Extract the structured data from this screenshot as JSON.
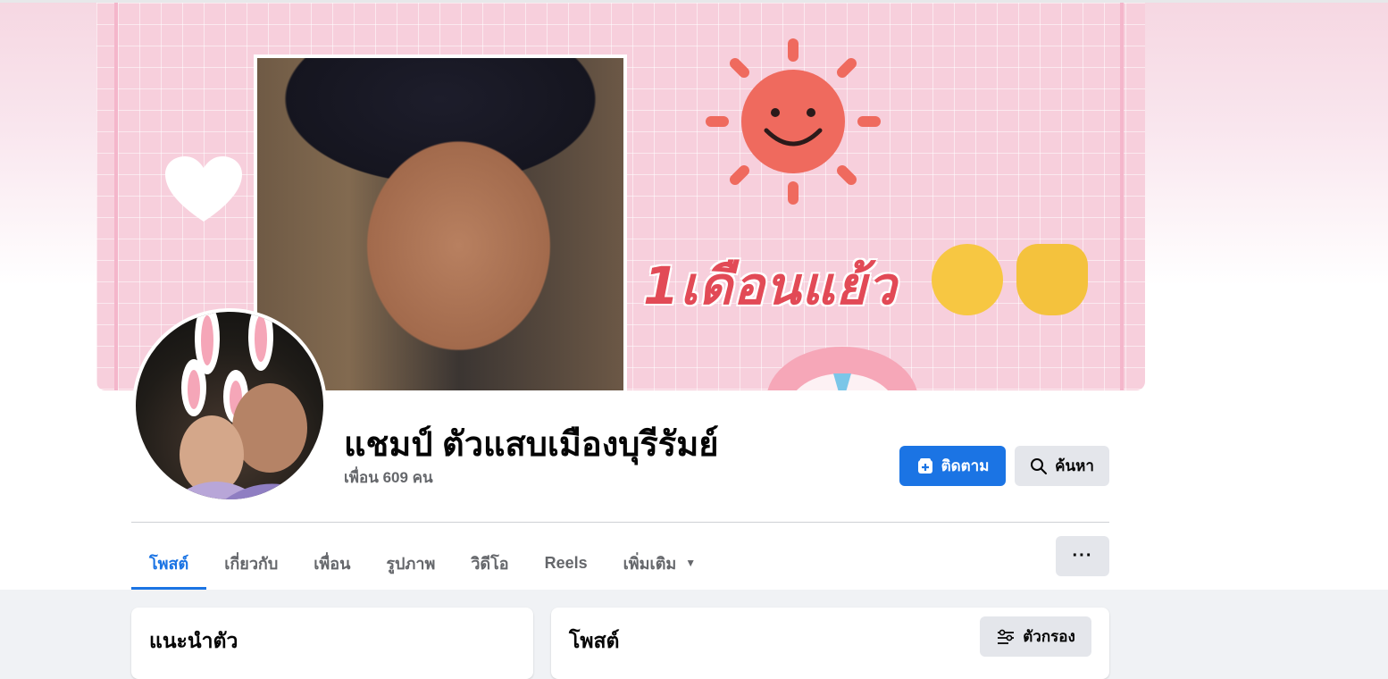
{
  "profile": {
    "name": "แชมป์ ตัวแสบเมืองบุรีรัมย์",
    "friends_count_text": "เพื่อน 609 คน"
  },
  "cover": {
    "caption_text": "1เดือนแย้ว"
  },
  "actions": {
    "follow_label": "ติดตาม",
    "search_label": "ค้นหา",
    "more_label": "···"
  },
  "tabs": [
    {
      "label": "โพสต์",
      "active": true
    },
    {
      "label": "เกี่ยวกับ",
      "active": false
    },
    {
      "label": "เพื่อน",
      "active": false
    },
    {
      "label": "รูปภาพ",
      "active": false
    },
    {
      "label": "วิดีโอ",
      "active": false
    },
    {
      "label": "Reels",
      "active": false
    },
    {
      "label": "เพิ่มเติม",
      "active": false
    }
  ],
  "cards": {
    "intro_title": "แนะนำตัว",
    "posts_title": "โพสต์",
    "filter_label": "ตัวกรอง"
  },
  "colors": {
    "accent": "#1b74e4",
    "cover_pink": "#f7cfdc",
    "caption_red": "#e24a56"
  }
}
